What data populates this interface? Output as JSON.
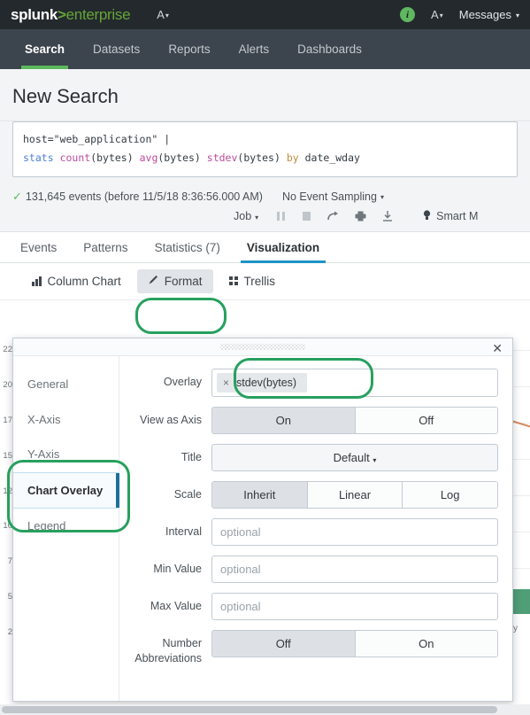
{
  "topbar": {
    "logo_primary": "splunk",
    "logo_separator": ">",
    "logo_secondary": "enterprise",
    "activity_icon_label": "A",
    "info_icon_label": "i",
    "messages_label": "Messages",
    "caret": "▾",
    "background": "#24292d",
    "accent_green": "#65a637"
  },
  "appnav": {
    "items": [
      {
        "label": "Search",
        "active": true
      },
      {
        "label": "Datasets",
        "active": false
      },
      {
        "label": "Reports",
        "active": false
      },
      {
        "label": "Alerts",
        "active": false
      },
      {
        "label": "Dashboards",
        "active": false
      }
    ],
    "active_underline_color": "#5cb85c"
  },
  "page": {
    "title": "New Search"
  },
  "search": {
    "line1_tokens": [
      {
        "text": "host=\"web_application\" |",
        "type": "plain"
      }
    ],
    "line2_tokens": [
      {
        "text": "stats",
        "type": "cmd"
      },
      {
        "text": "count",
        "type": "fn"
      },
      {
        "text": "(bytes)",
        "type": "plain"
      },
      {
        "text": "avg",
        "type": "fn"
      },
      {
        "text": "(bytes)",
        "type": "plain"
      },
      {
        "text": "stdev",
        "type": "fn"
      },
      {
        "text": "(bytes)",
        "type": "plain"
      },
      {
        "text": "by",
        "type": "kw"
      },
      {
        "text": "date_wday",
        "type": "plain"
      }
    ],
    "full_query": "host=\"web_application\" | stats count(bytes) avg(bytes) stdev(bytes) by date_wday"
  },
  "results_header": {
    "check_glyph": "✓",
    "events_text": "131,645 events (before 11/5/18 8:36:56.000 AM)",
    "event_count": "131,645",
    "sampling_label": "No Event Sampling",
    "job_label": "Job",
    "toolbar_icons": [
      "pause-icon",
      "stop-icon",
      "share-icon",
      "print-icon",
      "download-icon"
    ],
    "smart_mode_label": "Smart M"
  },
  "result_tabs": [
    {
      "label": "Events",
      "active": false
    },
    {
      "label": "Patterns",
      "active": false
    },
    {
      "label": "Statistics (7)",
      "active": false
    },
    {
      "label": "Visualization",
      "active": true
    }
  ],
  "viz_toolbar": {
    "chart_type_label": "Column Chart",
    "format_label": "Format",
    "trellis_label": "Trellis",
    "format_pressed": true
  },
  "format_modal": {
    "close_label": "✕",
    "sidebar": [
      {
        "label": "General",
        "active": false
      },
      {
        "label": "X-Axis",
        "active": false
      },
      {
        "label": "Y-Axis",
        "active": false
      },
      {
        "label": "Chart Overlay",
        "active": true
      },
      {
        "label": "Legend",
        "active": false
      }
    ],
    "rows": {
      "overlay": {
        "label": "Overlay",
        "chip_remove": "×",
        "chip_label": "stdev(bytes)"
      },
      "view_as_axis": {
        "label": "View as Axis",
        "options": [
          "On",
          "Off"
        ],
        "selected": "On"
      },
      "title": {
        "label": "Title",
        "value": "Default",
        "caret": "▾"
      },
      "scale": {
        "label": "Scale",
        "options": [
          "Inherit",
          "Linear",
          "Log"
        ],
        "selected": "Inherit"
      },
      "interval": {
        "label": "Interval",
        "placeholder": "optional",
        "value": ""
      },
      "min_value": {
        "label": "Min Value",
        "placeholder": "optional",
        "value": ""
      },
      "max_value": {
        "label": "Max Value",
        "placeholder": "optional",
        "value": ""
      },
      "number_abbreviations": {
        "label_line1": "Number",
        "label_line2": "Abbreviations",
        "options": [
          "Off",
          "On"
        ],
        "selected": "Off"
      }
    }
  },
  "annotations": {
    "color": "#27a05e",
    "targets": [
      "format-button",
      "overlay-field",
      "chart-overlay-sidebar-item"
    ]
  },
  "chart_background": {
    "y_tick_labels": [
      "22",
      "20",
      "17",
      "15",
      "12",
      "10",
      "7",
      "5",
      "2"
    ],
    "overlay_series_color": "#d98b5f",
    "column_series_color": "#4f9e78",
    "x_label_partial": "y"
  }
}
